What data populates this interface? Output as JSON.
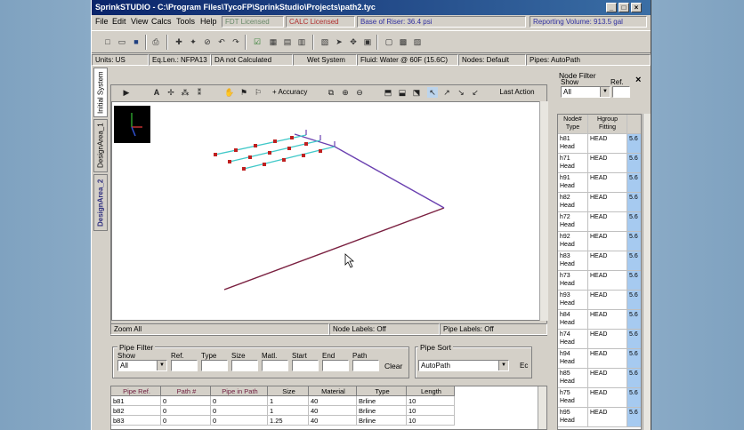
{
  "window": {
    "title": "SprinkSTUDIO - C:\\Program Files\\TycoFP\\SprinkStudio\\Projects\\path2.tyc",
    "min": "_",
    "max": "□",
    "close": "×"
  },
  "menu": [
    "File",
    "Edit",
    "View",
    "Calcs",
    "Tools",
    "Help"
  ],
  "license": {
    "fdt": "FDT Licensed",
    "calc": "CALC Licensed",
    "riser": "Base of Riser: 36.4 psi",
    "volume": "Reporting Volume: 913.5 gal"
  },
  "status": {
    "units": "Units: US",
    "eqlen": "Eq.Len.: NFPA13",
    "da": "DA not Calculated",
    "system": "Wet System",
    "fluid": "Fluid: Water @ 60F (15.6C)",
    "nodes": "Nodes: Default",
    "pipes": "Pipes: AutoPath"
  },
  "side_tabs": [
    "Initial System",
    "DesignArea_1",
    "DesignArea_2"
  ],
  "viewer": {
    "accuracy": "+ Accuracy",
    "last_action": "Last Action",
    "zoom_status": "Zoom All",
    "node_labels": "Node Labels: Off",
    "pipe_labels": "Pipe Labels: Off"
  },
  "pipe_filter": {
    "title": "Pipe Filter",
    "show_label": "Show",
    "show_value": "All",
    "fields": [
      "Ref.",
      "Type",
      "Size",
      "Matl.",
      "Start",
      "End",
      "Path"
    ],
    "clear": "Clear",
    "sort_title": "Pipe Sort",
    "sort_value": "AutoPath",
    "extra": "Ec"
  },
  "pipe_table": {
    "headers": [
      "Pipe Ref.",
      "Path #",
      "Pipe in Path",
      "Size",
      "Material",
      "Type",
      "Length"
    ],
    "rows": [
      [
        "b81",
        "0",
        "0",
        "1",
        "40",
        "Brline",
        "10"
      ],
      [
        "b82",
        "0",
        "0",
        "1",
        "40",
        "Brline",
        "10"
      ],
      [
        "b83",
        "0",
        "0",
        "1.25",
        "40",
        "Brline",
        "10"
      ]
    ]
  },
  "node_filter": {
    "title": "Node Filter",
    "show_label": "Show",
    "ref_label": "Ref.",
    "show_value": "All",
    "close": "×",
    "headers": [
      "Node# Type",
      "Hgroup Fitting",
      ""
    ],
    "rows": [
      [
        "h81",
        "Head",
        "HEAD",
        "5.6"
      ],
      [
        "h71",
        "Head",
        "HEAD",
        "5.6"
      ],
      [
        "h91",
        "Head",
        "HEAD",
        "5.6"
      ],
      [
        "h82",
        "Head",
        "HEAD",
        "5.6"
      ],
      [
        "h72",
        "Head",
        "HEAD",
        "5.6"
      ],
      [
        "h92",
        "Head",
        "HEAD",
        "5.6"
      ],
      [
        "h83",
        "Head",
        "HEAD",
        "5.6"
      ],
      [
        "h73",
        "Head",
        "HEAD",
        "5.6"
      ],
      [
        "h93",
        "Head",
        "HEAD",
        "5.6"
      ],
      [
        "h84",
        "Head",
        "HEAD",
        "5.6"
      ],
      [
        "h74",
        "Head",
        "HEAD",
        "5.6"
      ],
      [
        "h94",
        "Head",
        "HEAD",
        "5.6"
      ],
      [
        "h85",
        "Head",
        "HEAD",
        "5.6"
      ],
      [
        "h75",
        "Head",
        "HEAD",
        "5.6"
      ],
      [
        "h95",
        "Head",
        "HEAD",
        "5.6"
      ]
    ]
  }
}
